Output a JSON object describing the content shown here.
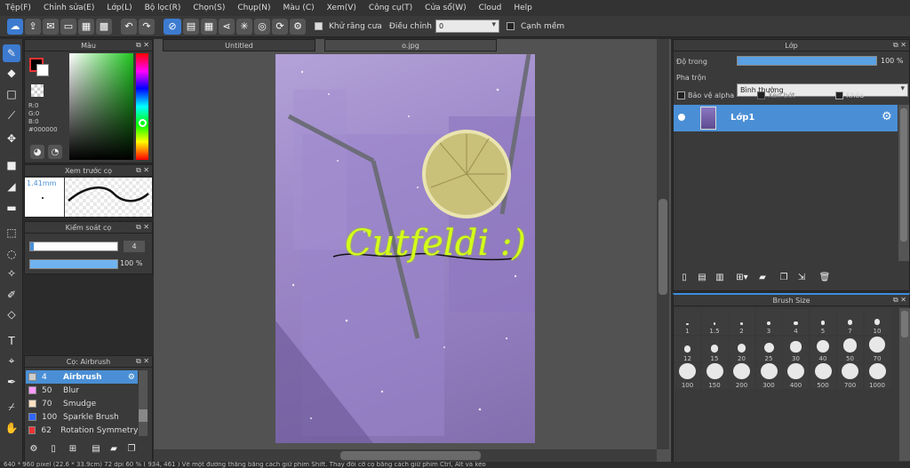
{
  "menu": [
    "Tệp(F)",
    "Chỉnh sửa(E)",
    "Lớp(L)",
    "Bộ lọc(R)",
    "Chọn(S)",
    "Chụp(N)",
    "Màu (C)",
    "Xem(V)",
    "Công cụ(T)",
    "Cửa sổ(W)",
    "Cloud",
    "Help"
  ],
  "toolbar": {
    "antialias_label": "Khử răng cưa",
    "adjust_label": "Điều chỉnh",
    "adjust_value": "0",
    "smooth_label": "Cạnh mềm"
  },
  "color_panel": {
    "title": "Màu",
    "r": "R:0",
    "g": "G:0",
    "b": "B:0",
    "hex": "#000000",
    "primary_color": "#000000",
    "secondary_color": "#ffffff",
    "picker_hue": "#1ec51e"
  },
  "brush_preview": {
    "title": "Xem trước cọ",
    "size": "1.41mm"
  },
  "brush_control": {
    "title": "Kiểm soát cọ",
    "size_value": "4",
    "opacity_value": "100 %",
    "opacity_fraction": 1.0
  },
  "brush_list": {
    "title": "Cọ: Airbrush",
    "items": [
      {
        "size": "4",
        "name": "Airbrush",
        "color": "#cccccc",
        "selected": true
      },
      {
        "size": "50",
        "name": "Blur",
        "color": "#ff99ff",
        "selected": false
      },
      {
        "size": "70",
        "name": "Smudge",
        "color": "#ffe0c0",
        "selected": false
      },
      {
        "size": "100",
        "name": "Sparkle Brush",
        "color": "#3366ff",
        "selected": false
      },
      {
        "size": "62",
        "name": "Rotation Symmetry F",
        "color": "#ee3333",
        "selected": false
      }
    ]
  },
  "tabs": [
    "Untitled",
    "o.jpg"
  ],
  "canvas": {
    "text": "Cutfeldi :)"
  },
  "layer_panel": {
    "title": "Lớp",
    "opacity_label": "Độ trong",
    "opacity_value": "100 %",
    "opacity_fraction": 1.0,
    "blend_label": "Pha trộn",
    "blend_value": "Bình thường",
    "protect_alpha": "Bảo vệ alpha",
    "clipping": "Xén bớt",
    "lock": "Khóa",
    "layer_name": "Lớp1"
  },
  "brush_size_panel": {
    "title": "Brush Size",
    "sizes": [
      "1",
      "1.5",
      "2",
      "3",
      "4",
      "5",
      "7",
      "10",
      "12",
      "15",
      "20",
      "25",
      "30",
      "40",
      "50",
      "70",
      "100",
      "150",
      "200",
      "300",
      "400",
      "500",
      "700",
      "1000"
    ]
  },
  "status": "640 * 960 pixel  (22.6 * 33.9cm)  72 dpi  60 %  ( 934, 461 )  Vẽ một đường thẳng bằng cách giữ phím Shift. Thay đổi cỡ cọ bằng cách giữ phím Ctrl, Alt và kéo"
}
